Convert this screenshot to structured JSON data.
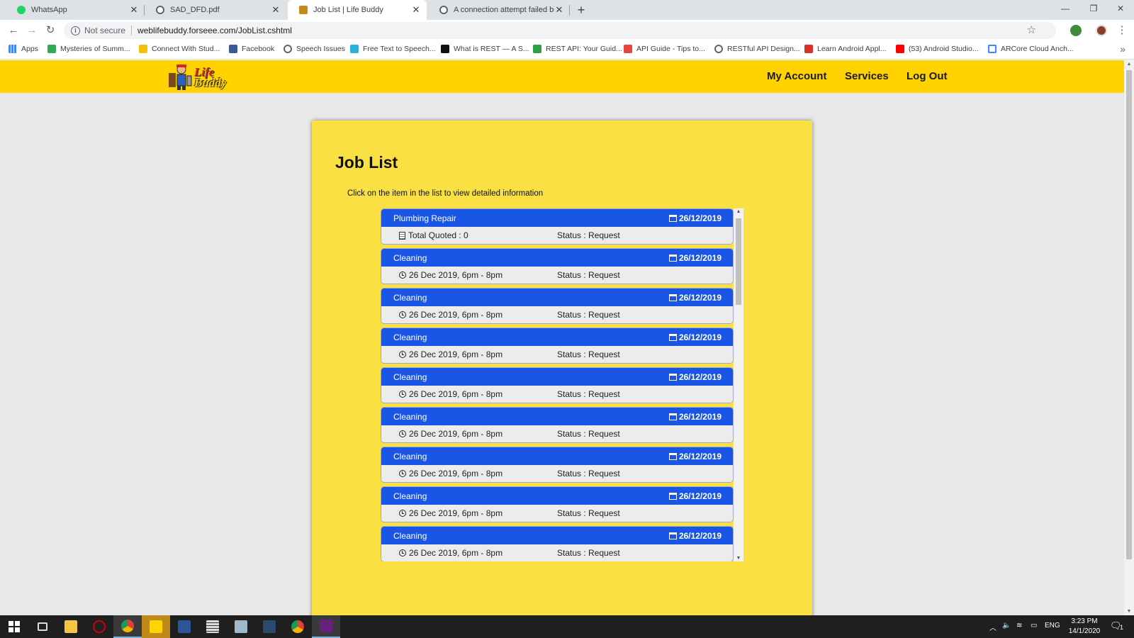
{
  "browser": {
    "tabs": [
      {
        "title": "WhatsApp",
        "favicon": "whatsapp-icon"
      },
      {
        "title": "SAD_DFD.pdf",
        "favicon": "globe-icon"
      },
      {
        "title": "Job List | Life Buddy",
        "favicon": "lifebuddy-icon"
      },
      {
        "title": "A connection attempt failed beca",
        "favicon": "globe-icon"
      }
    ],
    "not_secure": "Not secure",
    "url": "weblifebuddy.forseee.com/JobList.cshtml",
    "bookmarks": [
      "Apps",
      "Mysteries of Summ...",
      "Connect With Stud...",
      "Facebook",
      "Speech Issues",
      "Free Text to Speech...",
      "What is REST — A S...",
      "REST API: Your Guid...",
      "API Guide - Tips to...",
      "RESTful API Design...",
      "Learn Android Appl...",
      "(53) Android Studio...",
      "ARCore Cloud Anch..."
    ]
  },
  "site": {
    "logo_line1": "Life",
    "logo_line2": "Buddy",
    "nav": [
      "My Account",
      "Services",
      "Log Out"
    ],
    "accent": "#ffd200"
  },
  "page": {
    "title": "Job List",
    "hint": "Click on the item in the list to view detailed information",
    "jobs": [
      {
        "name": "Plumbing Repair",
        "date": "26/12/2019",
        "detail": "Total Quoted : 0",
        "detail_icon": "document-icon",
        "status": "Status : Request"
      },
      {
        "name": "Cleaning",
        "date": "26/12/2019",
        "detail": "26 Dec 2019, 6pm - 8pm",
        "detail_icon": "clock-icon",
        "status": "Status : Request"
      },
      {
        "name": "Cleaning",
        "date": "26/12/2019",
        "detail": "26 Dec 2019, 6pm - 8pm",
        "detail_icon": "clock-icon",
        "status": "Status : Request"
      },
      {
        "name": "Cleaning",
        "date": "26/12/2019",
        "detail": "26 Dec 2019, 6pm - 8pm",
        "detail_icon": "clock-icon",
        "status": "Status : Request"
      },
      {
        "name": "Cleaning",
        "date": "26/12/2019",
        "detail": "26 Dec 2019, 6pm - 8pm",
        "detail_icon": "clock-icon",
        "status": "Status : Request"
      },
      {
        "name": "Cleaning",
        "date": "26/12/2019",
        "detail": "26 Dec 2019, 6pm - 8pm",
        "detail_icon": "clock-icon",
        "status": "Status : Request"
      },
      {
        "name": "Cleaning",
        "date": "26/12/2019",
        "detail": "26 Dec 2019, 6pm - 8pm",
        "detail_icon": "clock-icon",
        "status": "Status : Request"
      },
      {
        "name": "Cleaning",
        "date": "26/12/2019",
        "detail": "26 Dec 2019, 6pm - 8pm",
        "detail_icon": "clock-icon",
        "status": "Status : Request"
      },
      {
        "name": "Cleaning",
        "date": "26/12/2019",
        "detail": "26 Dec 2019, 6pm - 8pm",
        "detail_icon": "clock-icon",
        "status": "Status : Request"
      }
    ],
    "job_header_color": "#1a56e6"
  },
  "taskbar": {
    "lang": "ENG",
    "time": "3:23 PM",
    "date": "14/1/2020",
    "notification_count": "1"
  }
}
